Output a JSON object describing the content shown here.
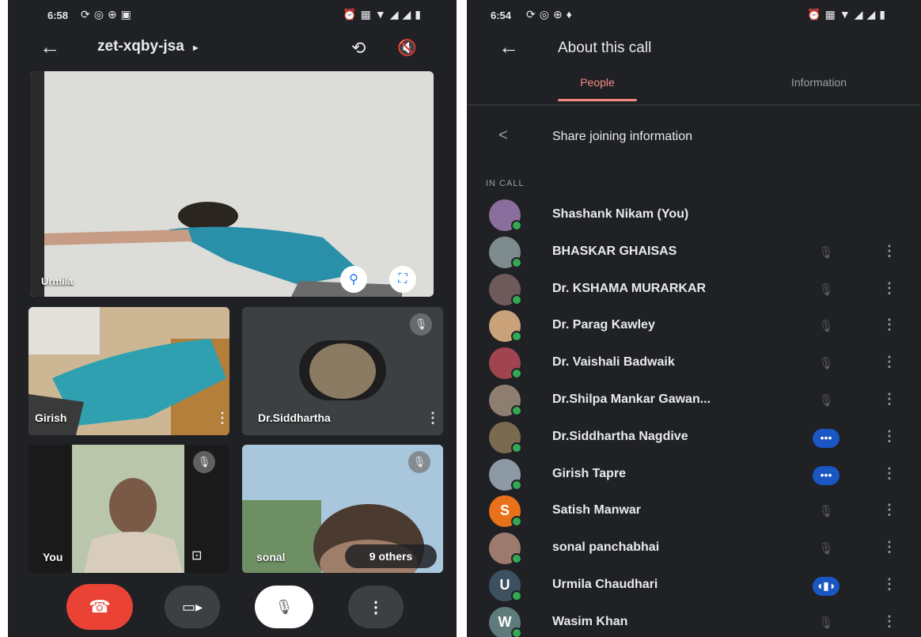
{
  "left_screen": {
    "status": {
      "time": "6:58"
    },
    "meeting_code": "zet-xqby-jsa",
    "tiles": {
      "main": {
        "name": "Urmila"
      },
      "girish": {
        "name": "Girish"
      },
      "siddhartha": {
        "name": "Dr.Siddhartha"
      },
      "you": {
        "name": "You"
      },
      "sonal": {
        "name": "sonal",
        "others_label": "9 others"
      }
    }
  },
  "right_screen": {
    "status": {
      "time": "6:54"
    },
    "title": "About this call",
    "tabs": [
      {
        "label": "People",
        "active": true
      },
      {
        "label": "Information",
        "active": false
      }
    ],
    "share_label": "Share joining information",
    "section_label": "IN CALL",
    "participants": [
      {
        "name": "Shashank Nikam (You)",
        "avatar_color": "#8a6f9e",
        "mic": "none"
      },
      {
        "name": "BHASKAR GHAISAS",
        "avatar_color": "#7d8a8e",
        "mic": "muted"
      },
      {
        "name": "Dr. KSHAMA MURARKAR",
        "avatar_color": "#6e5a5a",
        "mic": "muted"
      },
      {
        "name": "Dr. Parag Kawley",
        "avatar_color": "#c9a27a",
        "mic": "muted"
      },
      {
        "name": "Dr. Vaishali Badwaik",
        "avatar_color": "#a04450",
        "mic": "muted"
      },
      {
        "name": "Dr.Shilpa Mankar Gawan...",
        "avatar_color": "#8d7e70",
        "mic": "muted"
      },
      {
        "name": "Dr.Siddhartha Nagdive",
        "avatar_color": "#7a6a50",
        "mic": "active"
      },
      {
        "name": "Girish Tapre",
        "avatar_color": "#8d9aa6",
        "mic": "active"
      },
      {
        "name": "Satish Manwar",
        "avatar_color": "#e8711a",
        "avatar_letter": "S",
        "mic": "muted"
      },
      {
        "name": "sonal panchabhai",
        "avatar_color": "#9c7a6e",
        "mic": "muted"
      },
      {
        "name": "Urmila Chaudhari",
        "avatar_color": "#3c5060",
        "avatar_letter": "U",
        "mic": "speaking"
      },
      {
        "name": "Wasim Khan",
        "avatar_color": "#5f7a7a",
        "avatar_letter": "W",
        "mic": "muted"
      }
    ]
  },
  "colors": {
    "background": "#202124",
    "end_call": "#ea4335",
    "tab_active": "#f28b82",
    "mic_active": "#1a56c4",
    "online_dot": "#34a853"
  }
}
